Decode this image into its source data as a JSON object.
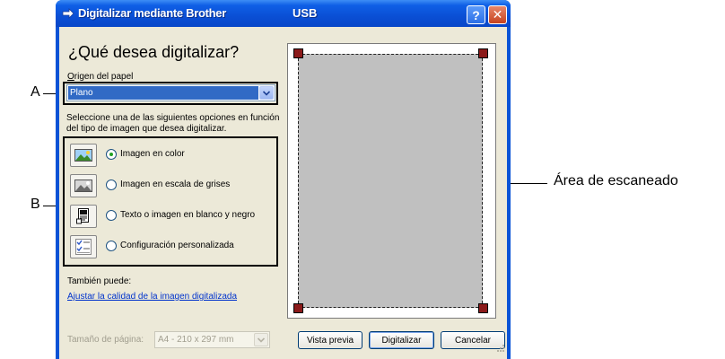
{
  "window": {
    "title": "Digitalizar mediante Brother",
    "connection": "USB",
    "help_label": "?",
    "close_label": "✕"
  },
  "main": {
    "heading": "¿Qué desea digitalizar?",
    "paper_source": {
      "label": "Origen del papel",
      "value": "Plano"
    },
    "instructions": "Seleccione una de las siguientes opciones en función del tipo de imagen que desea digitalizar.",
    "options": [
      {
        "label": "Imagen en color",
        "icon": "color-photo-icon",
        "selected": true
      },
      {
        "label": "Imagen en escala de grises",
        "icon": "grayscale-photo-icon",
        "selected": false
      },
      {
        "label": "Texto o imagen en blanco y negro",
        "icon": "bw-document-icon",
        "selected": false
      },
      {
        "label": "Configuración personalizada",
        "icon": "custom-settings-icon",
        "selected": false
      }
    ],
    "also_label": "También puede:",
    "adjust_link": "Ajustar la calidad de la imagen digitalizada",
    "page_size": {
      "label": "Tamaño de página:",
      "value": "A4 - 210 x 297 mm"
    }
  },
  "buttons": {
    "preview": "Vista previa",
    "scan": "Digitalizar",
    "cancel": "Cancelar"
  },
  "annotations": {
    "a": "A",
    "b": "B",
    "scan_area": "Área de escaneado"
  },
  "colors": {
    "titlebar": "#0a53d6",
    "dialog_bg": "#ece9d8",
    "selection": "#316ac5",
    "link": "#0033cc",
    "scan_area": "#c0c0c0",
    "handle": "#8b1a1a"
  }
}
